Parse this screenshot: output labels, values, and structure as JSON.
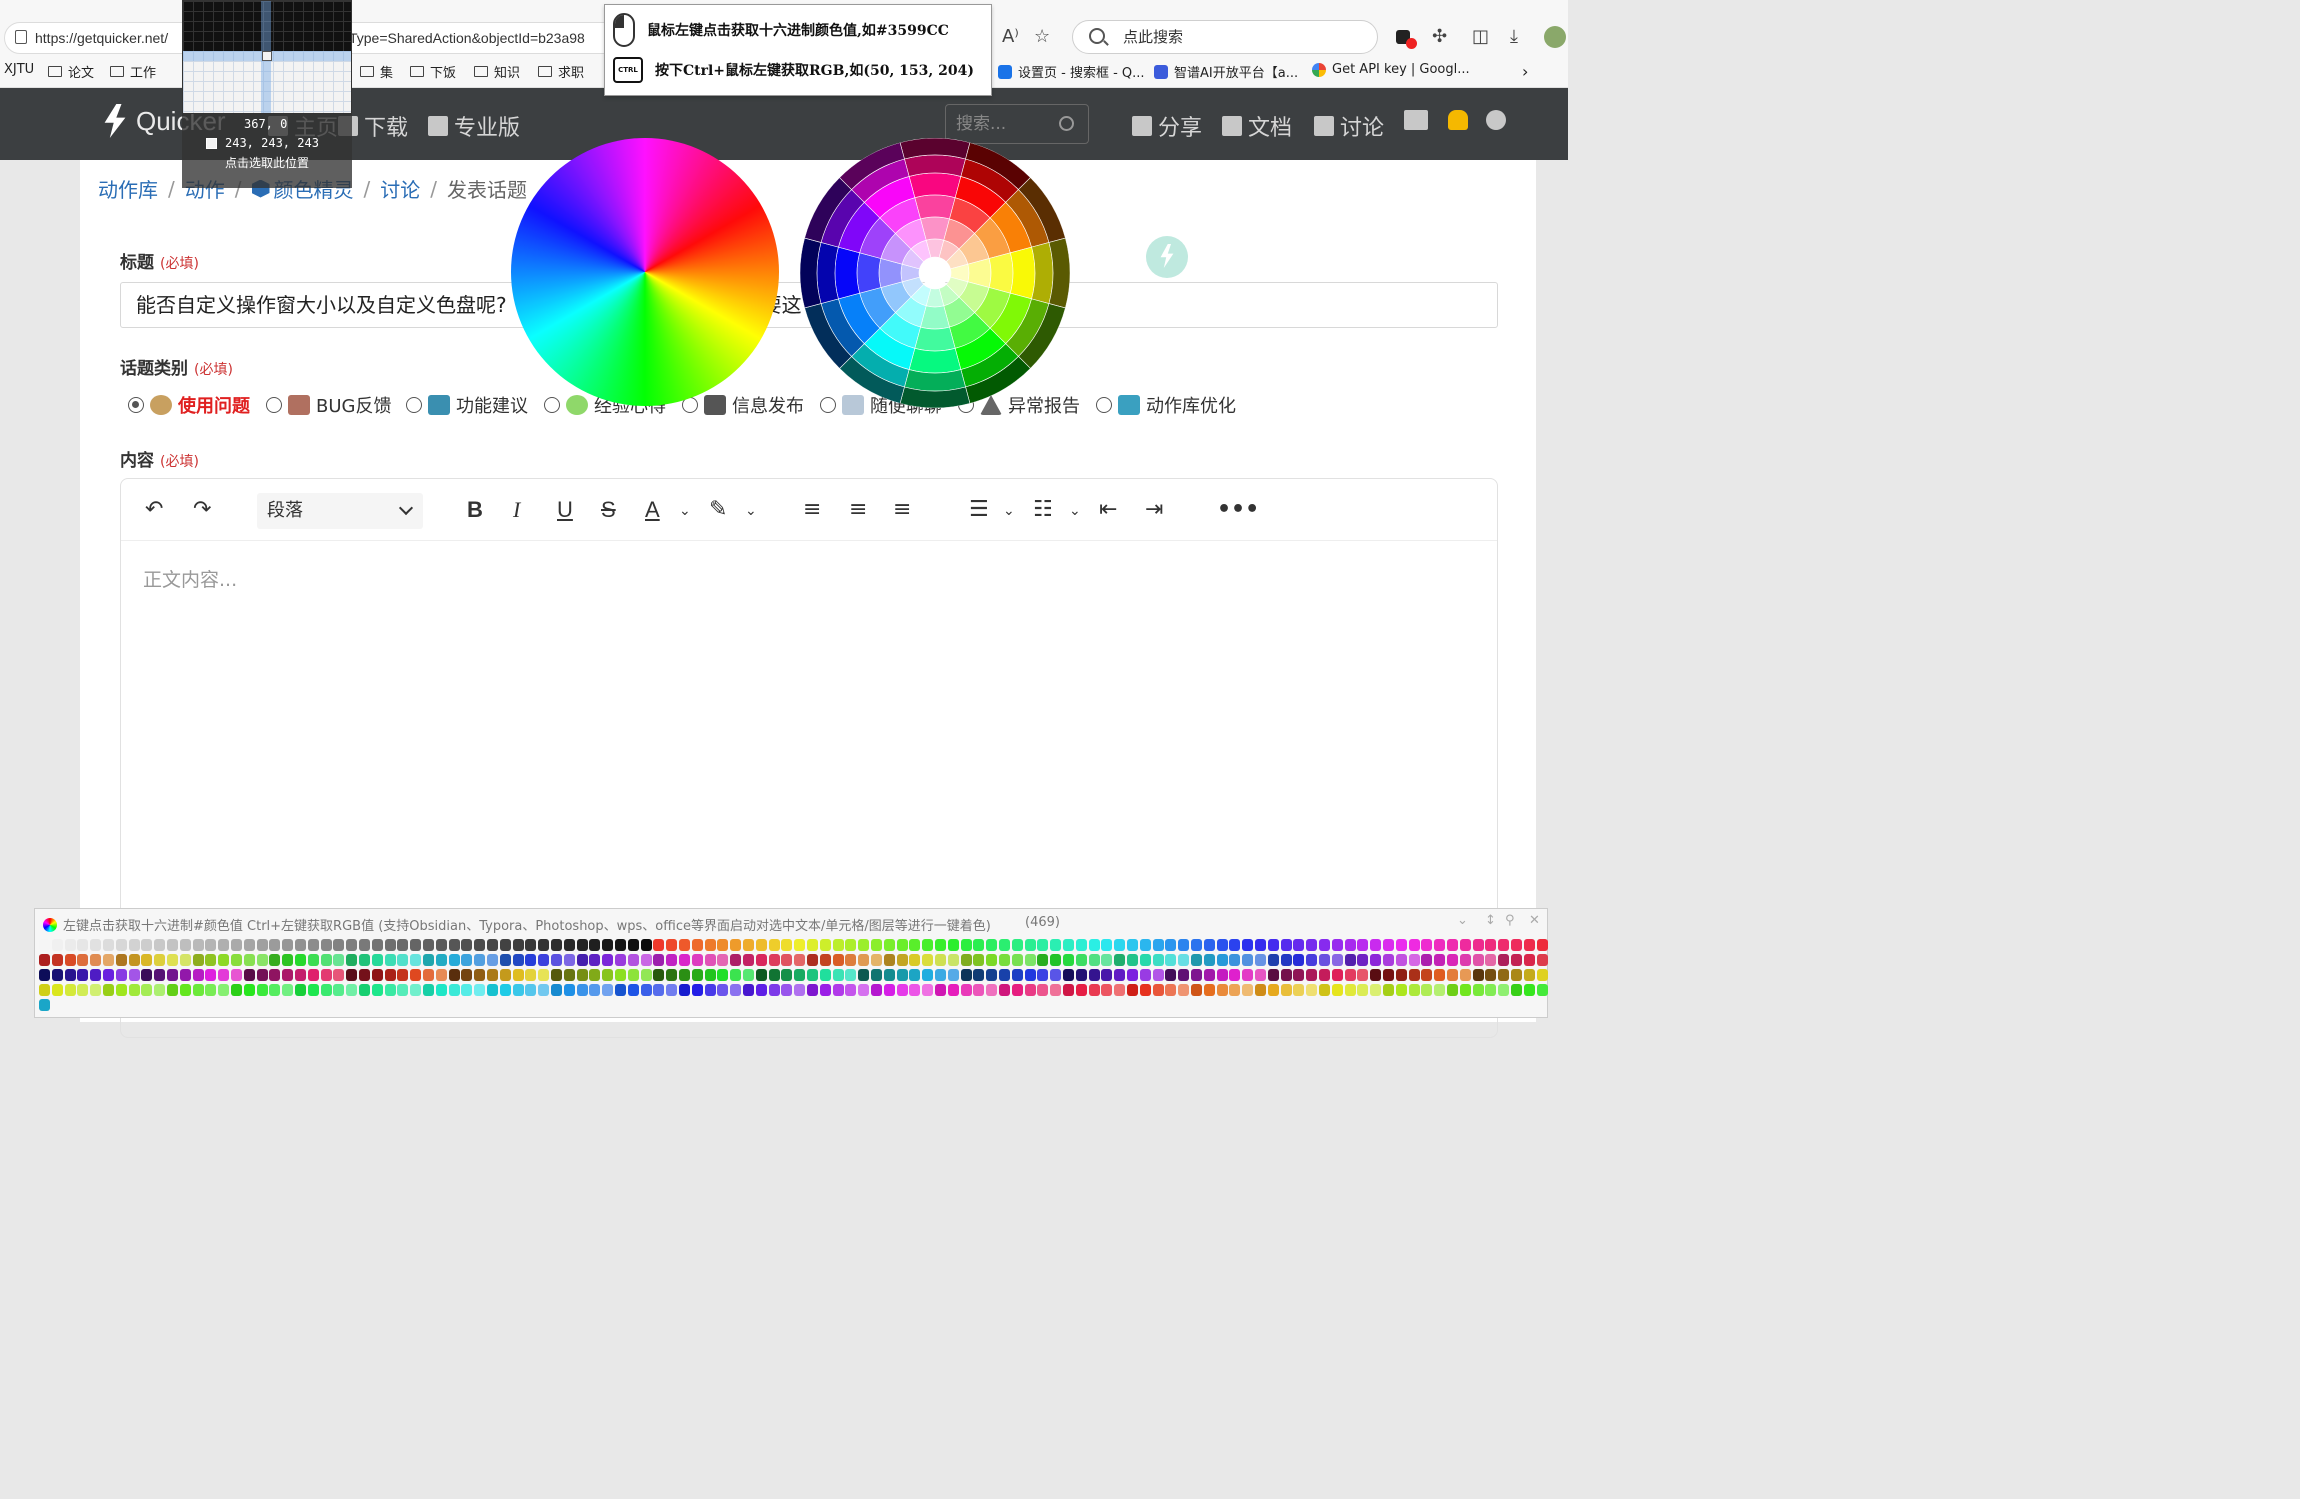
{
  "browser": {
    "url_prefix": "https://getquicker.net/",
    "url_suffix": "ctType=SharedAction&objectId=b23a98",
    "search_placeholder": "点此搜索",
    "bookmarks": [
      {
        "label": "XJTU",
        "folder": false
      },
      {
        "label": "论文",
        "folder": true
      },
      {
        "label": "工作",
        "folder": true
      },
      {
        "label": "集",
        "folder": true
      },
      {
        "label": "下饭",
        "folder": true
      },
      {
        "label": "知识",
        "folder": true
      },
      {
        "label": "求职",
        "folder": true
      },
      {
        "label": "设置页 - 搜索框 - Q...",
        "folder": false
      },
      {
        "label": "智谱AI开放平台【a...",
        "folder": false
      },
      {
        "label": "Get API key | Googl...",
        "folder": false
      }
    ]
  },
  "site_nav": {
    "brand": "Quicker",
    "items": [
      "主页",
      "下载",
      "专业版"
    ],
    "search_placeholder": "搜索...",
    "right_items": [
      "分享",
      "文档",
      "讨论"
    ]
  },
  "breadcrumb": {
    "items": [
      "动作库",
      "动作",
      "颜色精灵",
      "讨论",
      "发表话题"
    ]
  },
  "form": {
    "title_label": "标题",
    "required": "(必填)",
    "title_value": "能否自定义操作窗大小以及自定义色盘呢?",
    "title_value_tail": "要这",
    "category_label": "话题类别",
    "categories": [
      {
        "label": "使用问题",
        "checked": true
      },
      {
        "label": "BUG反馈",
        "checked": false
      },
      {
        "label": "功能建议",
        "checked": false
      },
      {
        "label": "经验心得",
        "checked": false
      },
      {
        "label": "信息发布",
        "checked": false
      },
      {
        "label": "随便聊聊",
        "checked": false
      },
      {
        "label": "异常报告",
        "checked": false
      },
      {
        "label": "动作库优化",
        "checked": false
      }
    ],
    "content_label": "内容",
    "paragraph_select": "段落",
    "content_placeholder": "正文内容..."
  },
  "magnifier": {
    "coord": "367, 0",
    "rgb": "243, 243, 243",
    "hint": "点击选取此位置",
    "swatch_color": "#f3f3f3"
  },
  "tooltip": {
    "line1": "鼠标左键点击获取十六进制颜色值,如#3599CC",
    "line2": "按下Ctrl+鼠标左键获取RGB,如(50, 153, 204)",
    "ctrl_key": "CTRL"
  },
  "palette": {
    "title": "左键点击获取十六进制#颜色值  Ctrl+左键获取RGB值   (支持Obsidian、Typora、Photoshop、wps、office等界面启动对选中文本/单元格/图层等进行一键着色)",
    "count": "(469)"
  },
  "colors": {
    "navbar": "#3c3f41",
    "link": "#2a6db5",
    "selected_category": "#e02020"
  }
}
